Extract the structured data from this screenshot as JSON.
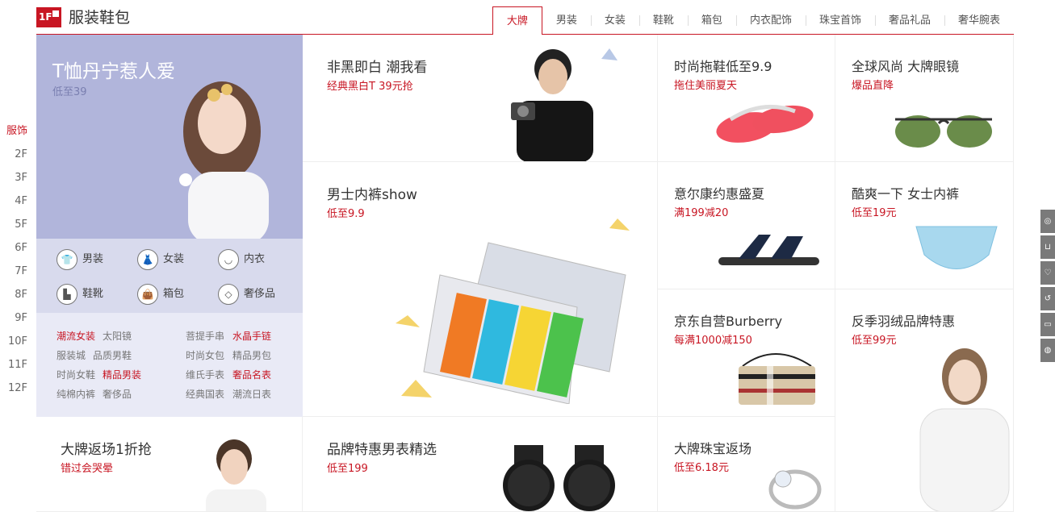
{
  "floor": {
    "badge": "1F",
    "title": "服装鞋包"
  },
  "tabs": [
    "大牌",
    "男装",
    "女装",
    "鞋靴",
    "箱包",
    "内衣配饰",
    "珠宝首饰",
    "奢品礼品",
    "奢华腕表"
  ],
  "elevator": [
    "服饰",
    "2F",
    "3F",
    "4F",
    "5F",
    "6F",
    "7F",
    "8F",
    "9F",
    "10F",
    "11F",
    "12F"
  ],
  "feature": {
    "title": "T恤丹宁惹人爱",
    "sub": "低至39"
  },
  "categories": [
    "男装",
    "女装",
    "内衣",
    "鞋靴",
    "箱包",
    "奢侈品"
  ],
  "links": {
    "row1": [
      "潮流女装",
      "太阳镜",
      "菩提手串",
      "水晶手链"
    ],
    "row2": [
      "服装城",
      "品质男鞋",
      "时尚女包",
      "精品男包"
    ],
    "row3": [
      "时尚女鞋",
      "精品男装",
      "维氏手表",
      "奢品名表"
    ],
    "row4": [
      "纯棉内裤",
      "奢侈品",
      "经典国表",
      "潮流日表"
    ]
  },
  "cards": {
    "c1": {
      "title": "非黑即白 潮我看",
      "sub": "经典黑白T 39元抢"
    },
    "c2": {
      "title": "男士内裤show",
      "sub": "低至9.9"
    },
    "c3": {
      "title": "品牌特惠男表精选",
      "sub": "低至199"
    },
    "c4": {
      "title": "大牌返场1折抢",
      "sub": "错过会哭晕"
    },
    "c5": {
      "title": "时尚拖鞋低至9.9",
      "sub": "拖住美丽夏天"
    },
    "c6": {
      "title": "全球风尚 大牌眼镜",
      "sub": "爆品直降"
    },
    "c7": {
      "title": "意尔康约惠盛夏",
      "sub": "满199减20"
    },
    "c8": {
      "title": "酷爽一下 女士内裤",
      "sub": "低至19元"
    },
    "c9": {
      "title": "京东自营Burberry",
      "sub": "每满1000减150"
    },
    "c10": {
      "title": "反季羽绒品牌特惠",
      "sub": "低至99元"
    },
    "c11": {
      "title": "大牌珠宝返场",
      "sub": "低至6.18元"
    }
  },
  "accent": "#c81623"
}
